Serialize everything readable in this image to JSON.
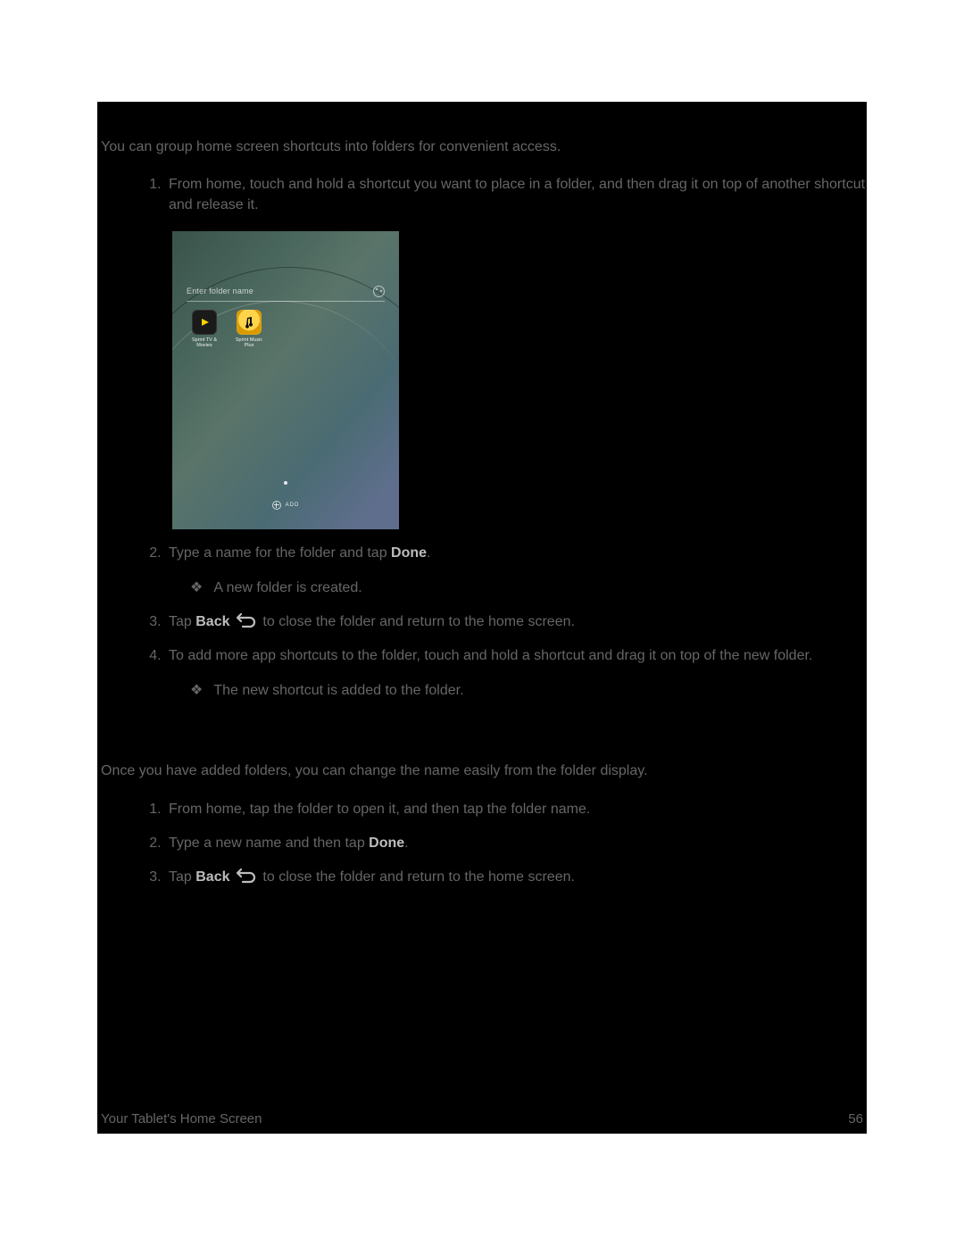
{
  "intro": "You can group home screen shortcuts into folders for convenient access.",
  "section1": {
    "items": [
      {
        "text": "From home, touch and hold a shortcut you want to place in a folder, and then drag it on top of another shortcut and release it."
      },
      {
        "text_a": "Type a name for the folder and tap ",
        "bold": "Done",
        "text_b": ".",
        "sub": [
          "A new folder is created."
        ]
      },
      {
        "text_a": "Tap ",
        "bold": "Back",
        "text_b": " to close the folder and return to the home screen.",
        "has_back_icon": true
      },
      {
        "text": "To add more app shortcuts to the folder, touch and hold a shortcut and drag it on top of the new folder.",
        "sub": [
          "The new shortcut is added to the folder."
        ]
      }
    ]
  },
  "between": "Once you have added folders, you can change the name easily from the folder display.",
  "section2": {
    "items": [
      {
        "text": "From home, tap the folder to open it, and then tap the folder name."
      },
      {
        "text_a": "Type a new name and then tap ",
        "bold": "Done",
        "text_b": "."
      },
      {
        "text_a": "Tap ",
        "bold": "Back",
        "text_b": " to close the folder and return to the home screen.",
        "has_back_icon": true
      }
    ]
  },
  "screenshot": {
    "folder_placeholder": "Enter folder name",
    "apps": [
      {
        "name": "Sprint TV &\nMovies"
      },
      {
        "name": "Sprint Music\nPlus"
      }
    ],
    "add_label": "ADD"
  },
  "footer": {
    "left": "Your Tablet's Home Screen",
    "right": "56"
  }
}
